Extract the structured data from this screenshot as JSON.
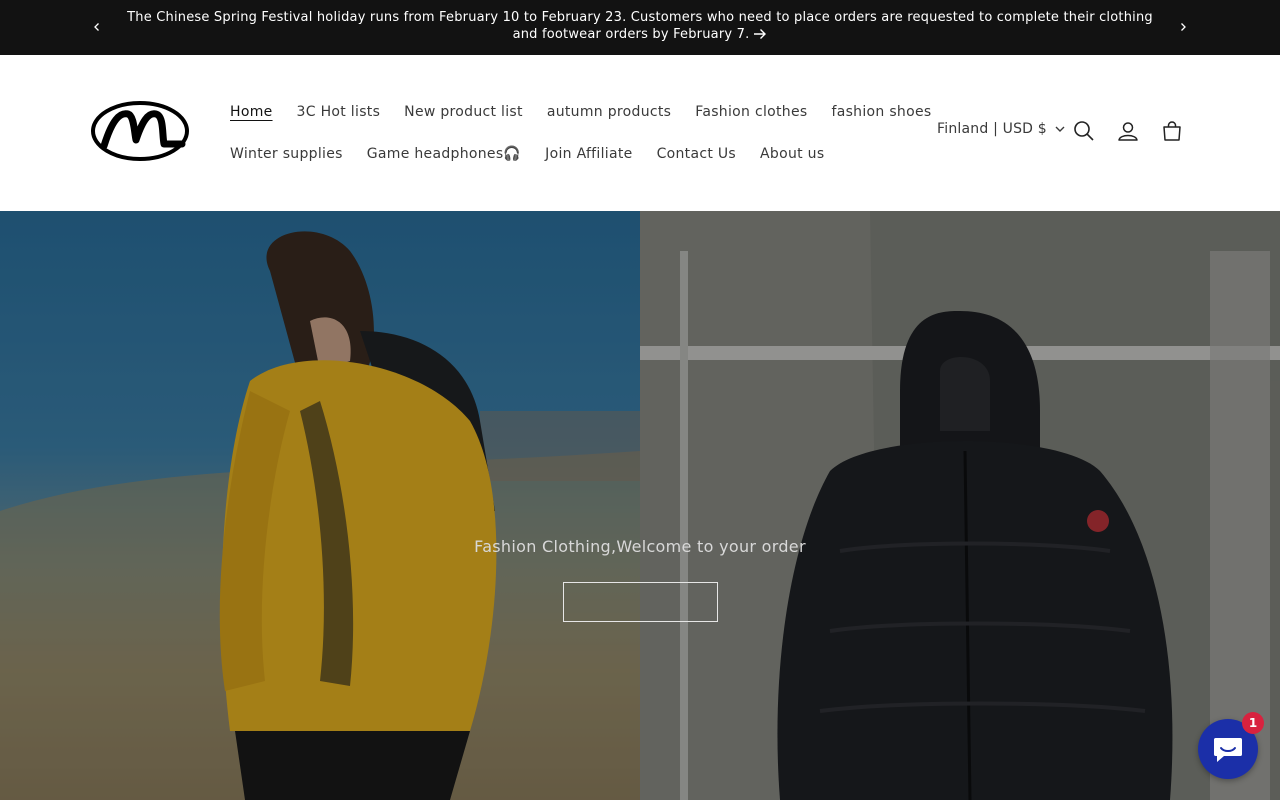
{
  "announcement": {
    "message": "The Chinese Spring Festival holiday runs from February 10 to February 23. Customers who need to place orders are requested to complete their clothing and footwear orders by February 7."
  },
  "header": {
    "nav_row1": [
      {
        "label": "Home",
        "active": true
      },
      {
        "label": "3C Hot lists"
      },
      {
        "label": "New product list"
      },
      {
        "label": "autumn products"
      },
      {
        "label": "Fashion clothes"
      },
      {
        "label": "fashion shoes"
      }
    ],
    "nav_row2": [
      {
        "label": "Winter supplies"
      },
      {
        "label": "Game headphones🎧"
      },
      {
        "label": "Join Affiliate"
      },
      {
        "label": "Contact Us"
      },
      {
        "label": "About us"
      }
    ],
    "country_selector": "Finland | USD $"
  },
  "hero": {
    "caption": "Fashion Clothing,Welcome to your order"
  },
  "chat": {
    "badge_count": "1"
  },
  "colors": {
    "announcement_bg": "#121212",
    "chat_bg": "#1b2fa8",
    "badge_bg": "#d8223f"
  }
}
